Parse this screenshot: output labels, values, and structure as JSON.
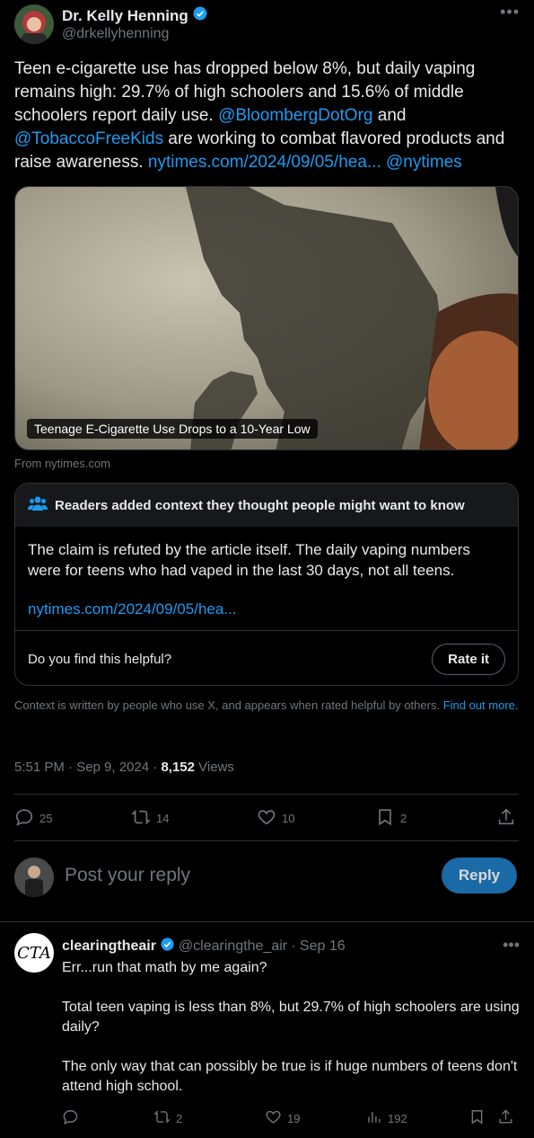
{
  "tweet": {
    "author_name": "Dr. Kelly Henning",
    "author_handle": "@drkellyhenning",
    "text_part1": "Teen e-cigarette use has dropped below 8%, but daily vaping remains high: 29.7% of high schoolers and 15.6% of middle schoolers report daily use. ",
    "mention1": "@BloombergDotOrg",
    "text_part2": " and ",
    "mention2": "@TobaccoFreeKids",
    "text_part3": " are working to combat flavored products and raise awareness. ",
    "link": "nytimes.com/2024/09/05/hea...",
    "mention3": "@nytimes",
    "media_caption": "Teenage E-Cigarette Use Drops to a 10-Year Low",
    "media_source": "From nytimes.com",
    "time": "5:51 PM · Sep 9, 2024 · ",
    "views_count": "8,152",
    "views_label": " Views",
    "stats": {
      "replies": "25",
      "reposts": "14",
      "likes": "10",
      "bookmarks": "2"
    }
  },
  "note": {
    "header": "Readers added context they thought people might want to know",
    "body": "The claim is refuted by the article itself. The daily vaping numbers were for teens who had vaped in the last 30 days, not all teens.",
    "link": "nytimes.com/2024/09/05/hea...",
    "question": "Do you find this helpful?",
    "rate_label": "Rate it",
    "context_text": "Context is written by people who use X, and appears when rated helpful by others. ",
    "find_out_more": "Find out more."
  },
  "reply_box": {
    "placeholder": "Post your reply",
    "button": "Reply"
  },
  "reply": {
    "avatar_text": "CTA",
    "author_name": "clearingtheair",
    "author_handle": "@clearingthe_air",
    "date": " · Sep 16",
    "text": "Err...run that math by me again?\n\nTotal teen vaping is less than 8%, but 29.7% of high schoolers are using daily?\n\nThe only way that can possibly be true is if huge numbers of teens don't attend high school.",
    "stats": {
      "reposts": "2",
      "likes": "19",
      "views": "192"
    }
  },
  "colors": {
    "accent": "#1d9bf0",
    "muted": "#71767b",
    "border": "#2f3336",
    "background": "#000000"
  }
}
